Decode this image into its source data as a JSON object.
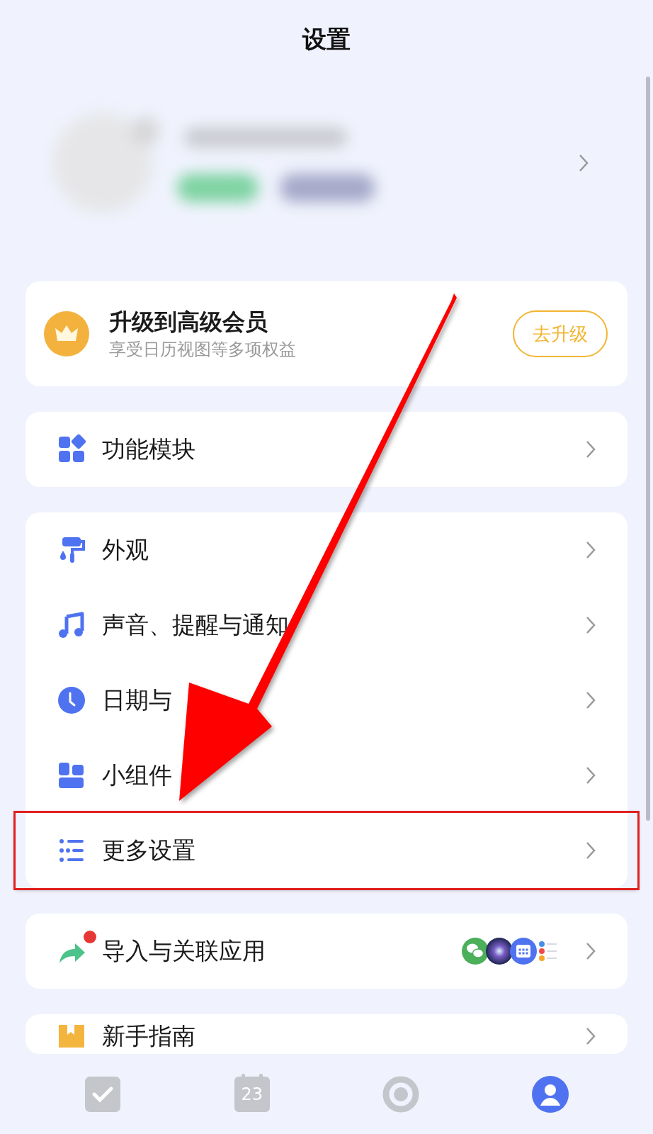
{
  "title": "设置",
  "premium": {
    "title": "升级到高级会员",
    "subtitle": "享受日历视图等多项权益",
    "button": "去升级"
  },
  "groups": [
    {
      "items": [
        {
          "kind": "modules",
          "label": "功能模块",
          "highlighted": false
        }
      ]
    },
    {
      "items": [
        {
          "kind": "paint",
          "label": "外观",
          "highlighted": false
        },
        {
          "kind": "music",
          "label": "声音、提醒与通知",
          "highlighted": false
        },
        {
          "kind": "clock",
          "label": "日期与",
          "highlighted": false
        },
        {
          "kind": "widget",
          "label": "小组件",
          "highlighted": false
        },
        {
          "kind": "list",
          "label": "更多设置",
          "highlighted": true
        }
      ]
    },
    {
      "items": [
        {
          "kind": "import",
          "label": "导入与关联应用",
          "highlighted": false,
          "notification_dot": true,
          "apps": [
            {
              "kind": "chat"
            },
            {
              "kind": "orb"
            },
            {
              "kind": "calendar"
            },
            {
              "kind": "list"
            }
          ]
        }
      ]
    },
    {
      "items": [
        {
          "kind": "guide",
          "label": "新手指南",
          "highlighted": false
        }
      ]
    }
  ],
  "nav": [
    {
      "kind": "check",
      "selected": false
    },
    {
      "kind": "calendar",
      "label": "23",
      "selected": false
    },
    {
      "kind": "focus",
      "selected": false
    },
    {
      "kind": "profile",
      "selected": true
    }
  ]
}
